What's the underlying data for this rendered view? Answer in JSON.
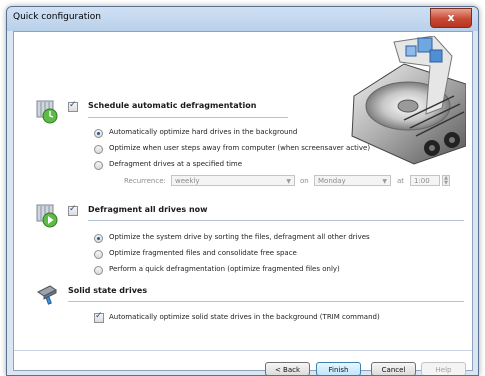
{
  "window": {
    "title": "Quick configuration",
    "close_glyph": "x"
  },
  "schedule": {
    "heading": "Schedule automatic defragmentation",
    "checked": true,
    "options": [
      {
        "label": "Automatically optimize hard drives in the background",
        "selected": true
      },
      {
        "label": "Optimize when user steps away from computer (when screensaver active)",
        "selected": false
      },
      {
        "label": "Defragment drives at a specified time",
        "selected": false
      }
    ],
    "recurrence_label": "Recurrence:",
    "recurrence_value": "weekly",
    "on_label": "on",
    "day_value": "Monday",
    "at_label": "at",
    "time_value": "1:00"
  },
  "defrag_now": {
    "heading": "Defragment all drives now",
    "checked": true,
    "options": [
      {
        "label": "Optimize the system drive by sorting the files, defragment all other drives",
        "selected": true
      },
      {
        "label": "Optimize fragmented files and consolidate free space",
        "selected": false
      },
      {
        "label": "Perform a quick defragmentation (optimize fragmented files only)",
        "selected": false
      }
    ]
  },
  "ssd": {
    "heading": "Solid state drives",
    "trim_label": "Automatically optimize solid state drives in the background (TRIM command)",
    "trim_checked": true
  },
  "buttons": {
    "back": "< Back",
    "finish": "Finish",
    "cancel": "Cancel",
    "help": "Help"
  },
  "icons": {
    "schedule": "scheduled-defrag-icon",
    "defrag_now": "defrag-now-icon",
    "ssd": "ssd-brush-icon",
    "illustration": "hard-drive-illustration"
  }
}
